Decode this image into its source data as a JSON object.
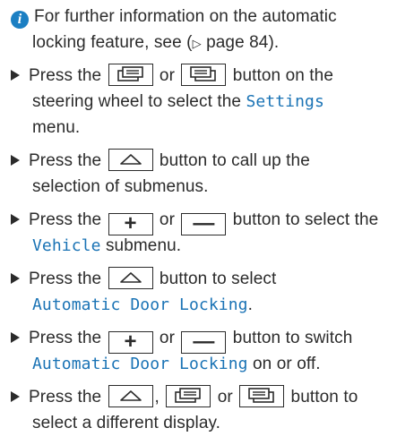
{
  "info": {
    "icon": "info-icon",
    "line1": "For further information on the automatic",
    "line2": "locking feature, see (",
    "arrow": "▷",
    "line2_end": " page 84)."
  },
  "steps": [
    {
      "l1_a": "Press the ",
      "l1_b": " or ",
      "l1_c": " button on the",
      "l2": "steering wheel to select the ",
      "l2_mono": "Settings",
      "l3": "menu."
    },
    {
      "l1_a": "Press the ",
      "l1_b": " button to call up the",
      "l2": "selection of submenus."
    },
    {
      "l1_a": "Press the ",
      "l1_b": " or ",
      "l1_c": " button to select the",
      "l2_mono": "Vehicle",
      "l2": " submenu."
    },
    {
      "l1_a": "Press the ",
      "l1_b": " button to select",
      "l2_mono": "Automatic Door Locking",
      "l2": "."
    },
    {
      "l1_a": "Press the ",
      "l1_b": " or ",
      "l1_c": " button to switch",
      "l2_mono": "Automatic Door Locking",
      "l2": " on or off."
    },
    {
      "l1_a": "Press the ",
      "l1_b": ", ",
      "l1_c": " or ",
      "l1_d": " button to",
      "l2": "select a different display."
    }
  ],
  "buttons": {
    "plus": "+",
    "minus": "—"
  },
  "colors": {
    "accent_text": "#1a73b5",
    "info_icon": "#1b7fc3",
    "body_text": "#2b2b2b"
  }
}
